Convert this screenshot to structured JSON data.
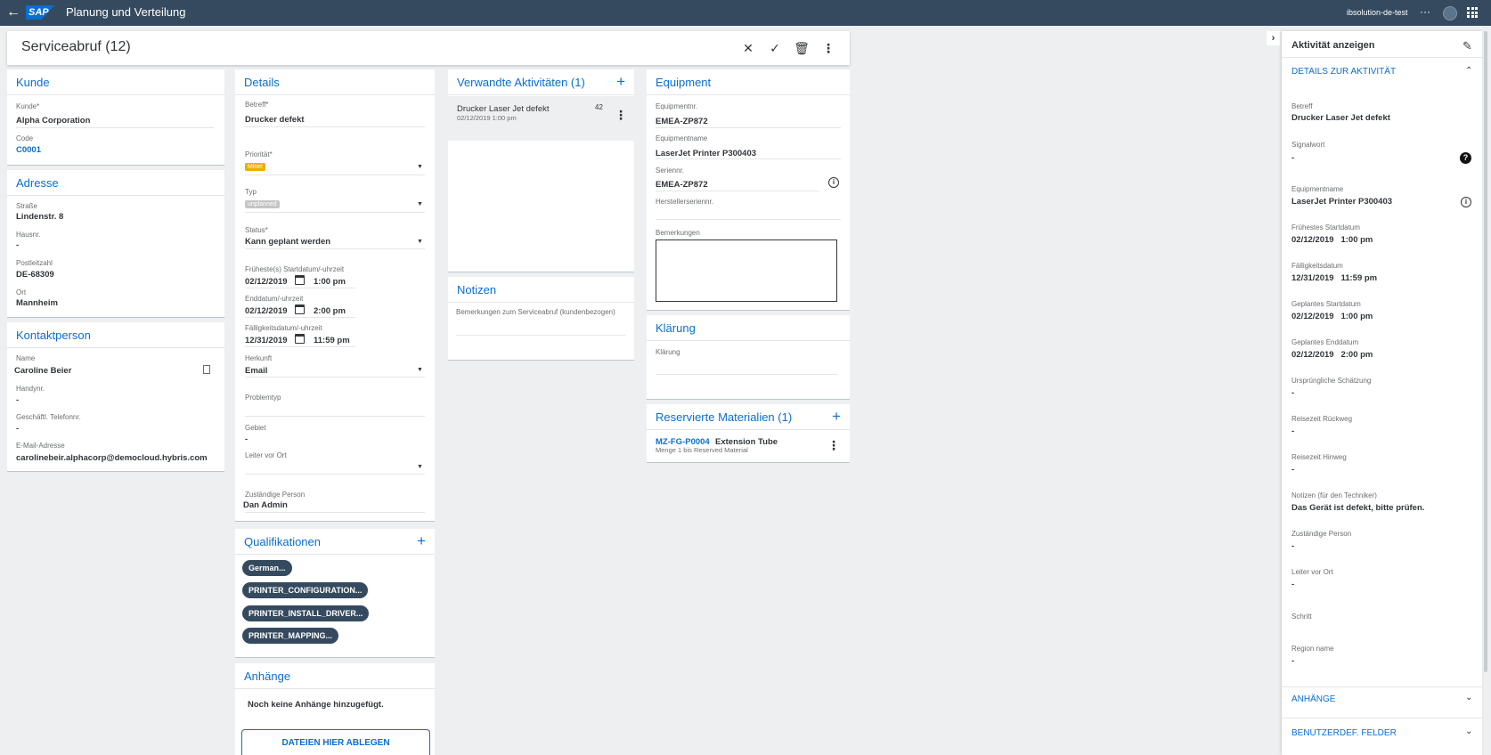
{
  "shell": {
    "logo": "SAP",
    "title": "Planung und Verteilung",
    "user": "ibsolution-de-test",
    "more": "···"
  },
  "header": {
    "title": "Serviceabruf (12)"
  },
  "kunde": {
    "title": "Kunde",
    "kunde_label": "Kunde*",
    "kunde_value": "Alpha Corporation",
    "code_label": "Code",
    "code_value": "C0001"
  },
  "adresse": {
    "title": "Adresse",
    "strasse_label": "Straße",
    "strasse_value": "Lindenstr. 8",
    "hausnr_label": "Hausnr.",
    "hausnr_value": "-",
    "plz_label": "Postleitzahl",
    "plz_value": "DE-68309",
    "ort_label": "Ort",
    "ort_value": "Mannheim"
  },
  "kontakt": {
    "title": "Kontaktperson",
    "name_label": "Name",
    "name_value": "Caroline Beier",
    "handy_label": "Handynr.",
    "handy_value": "-",
    "tel_label": "Geschäftl. Telefonnr.",
    "tel_value": "-",
    "email_label": "E-Mail-Adresse",
    "email_value": "carolinebeir.alphacorp@democloud.hybris.com"
  },
  "details": {
    "title": "Details",
    "betreff_label": "Betreff*",
    "betreff_value": "Drucker defekt",
    "prio_label": "Priorität*",
    "prio_value": "Mittel",
    "typ_label": "Typ",
    "typ_value": "unplanned",
    "status_label": "Status*",
    "status_value": "Kann geplant werden",
    "start_label": "Früheste(s) Startdatum/-uhrzeit",
    "start_date": "02/12/2019",
    "start_time": "1:00 pm",
    "end_label": "Enddatum/-uhrzeit",
    "end_date": "02/12/2019",
    "end_time": "2:00 pm",
    "due_label": "Fälligkeitsdatum/-uhrzeit",
    "due_date": "12/31/2019",
    "due_time": "11:59 pm",
    "herkunft_label": "Herkunft",
    "herkunft_value": "Email",
    "problem_label": "Problemtyp",
    "gebiet_label": "Gebiet",
    "gebiet_value": "-",
    "leiter_label": "Leiter vor Ort",
    "person_label": "Zuständige Person",
    "person_value": "Dan Admin"
  },
  "qualifikationen": {
    "title": "Qualifikationen",
    "chips": [
      "German...",
      "PRINTER_CONFIGURATION...",
      "PRINTER_INSTALL_DRIVER...",
      "PRINTER_MAPPING..."
    ]
  },
  "anhaenge": {
    "title": "Anhänge",
    "empty": "Noch keine Anhänge hinzugefügt.",
    "drop": "DATEIEN HIER ABLEGEN"
  },
  "aktivitaeten": {
    "title": "Verwandte Aktivitäten (1)",
    "item_title": "Drucker Laser Jet defekt",
    "item_count": "42",
    "item_date": "02/12/2019 1:00 pm"
  },
  "notizen": {
    "title": "Notizen",
    "placeholder": "Bemerkungen zum Serviceabruf (kundenbezogen)"
  },
  "equipment": {
    "title": "Equipment",
    "nr_label": "Equipmentnr.",
    "nr_value": "EMEA-ZP872",
    "name_label": "Equipmentname",
    "name_value": "LaserJet Printer P300403",
    "serien_label": "Seriennr.",
    "serien_value": "EMEA-ZP872",
    "hersteller_label": "Herstellerseriennr.",
    "bem_label": "Bemerkungen"
  },
  "klaerung": {
    "title": "Klärung",
    "label": "Klärung"
  },
  "materialien": {
    "title": "Reservierte Materialien (1)",
    "code": "MZ-FG-P0004",
    "name": "Extension Tube",
    "sub": "Menge 1 bis Reserved Material"
  },
  "panel": {
    "title": "Aktivität anzeigen",
    "section": "DETAILS ZUR AKTIVITÄT",
    "fields": [
      {
        "label": "Betreff",
        "value": "Drucker Laser Jet defekt"
      },
      {
        "label": "Signalwort",
        "value": "-"
      },
      {
        "label": "Equipmentname",
        "value": "LaserJet Printer P300403"
      },
      {
        "label": "Frühestes Startdatum",
        "value": "02/12/2019   1:00 pm"
      },
      {
        "label": "Fälligkeitsdatum",
        "value": "12/31/2019   11:59 pm"
      },
      {
        "label": "Geplantes Startdatum",
        "value": "02/12/2019   1:00 pm"
      },
      {
        "label": "Geplantes Enddatum",
        "value": "02/12/2019   2:00 pm"
      },
      {
        "label": "Ursprüngliche Schätzung",
        "value": "-"
      },
      {
        "label": "Reisezeit Rückweg",
        "value": "-"
      },
      {
        "label": "Reisezeit Hinweg",
        "value": "-"
      },
      {
        "label": "Notizen (für den Techniker)",
        "value": "Das Gerät ist defekt, bitte prüfen."
      },
      {
        "label": "Zuständige Person",
        "value": "-"
      },
      {
        "label": "Leiter vor Ort",
        "value": "-"
      },
      {
        "label": "Schritt",
        "value": ""
      },
      {
        "label": "Region name",
        "value": "-"
      }
    ],
    "anhaenge": "ANHÄNGE",
    "felder": "BENUTZERDEF. FELDER"
  }
}
